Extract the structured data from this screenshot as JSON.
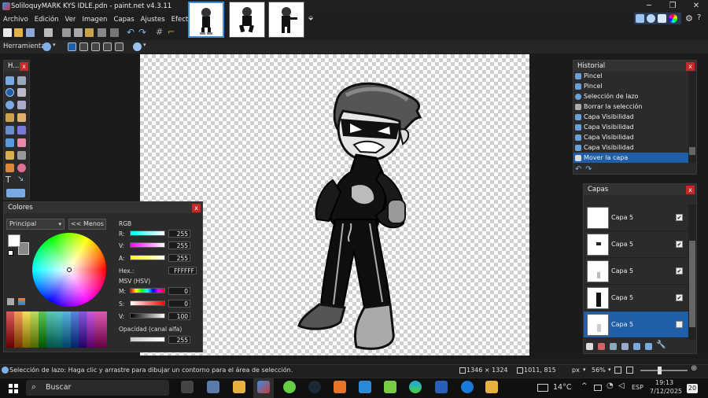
{
  "window": {
    "title": "SoliloquyMARK KYS IDLE.pdn - paint.net v4.3.11"
  },
  "menu": [
    "Archivo",
    "Edición",
    "Ver",
    "Imagen",
    "Capas",
    "Ajustes",
    "Efectos"
  ],
  "tool_options": {
    "label": "Herramienta:"
  },
  "tools_panel": {
    "title": "H..."
  },
  "colors_panel": {
    "title": "Colores",
    "mode": "Principal",
    "less_button": "<< Menos",
    "rgb_label": "RGB",
    "r_label": "R:",
    "g_label": "V:",
    "b_label": "A:",
    "r": "255",
    "g": "255",
    "b": "255",
    "hex_label": "Hex.:",
    "hex": "FFFFFF",
    "hsv_label": "MSV (HSV)",
    "h_label": "M:",
    "s_label": "S:",
    "v_label": "V:",
    "h": "0",
    "s": "0",
    "v": "100",
    "opacity_label": "Opacidad (canal alfa)",
    "opacity": "255"
  },
  "history_panel": {
    "title": "Historial",
    "items": [
      "Pincel",
      "Pincel",
      "Selección de lazo",
      "Borrar la selección",
      "Capa Visibilidad",
      "Capa Visibilidad",
      "Capa Visibilidad",
      "Capa Visibilidad",
      "Mover la capa"
    ],
    "selected_index": 8
  },
  "layers_panel": {
    "title": "Capas",
    "layers": [
      {
        "name": "Capa 5",
        "visible": true
      },
      {
        "name": "Capa 5",
        "visible": true
      },
      {
        "name": "Capa 5",
        "visible": true
      },
      {
        "name": "Capa 5",
        "visible": true
      },
      {
        "name": "Capa 5",
        "visible": false
      }
    ],
    "selected_index": 4
  },
  "status": {
    "hint": "Selección de lazo: Haga clic y arrastre para dibujar un contorno para el área de selección.",
    "image_size": "1346 × 1324",
    "cursor": "1011, 815",
    "units": "px",
    "zoom": "56%"
  },
  "taskbar": {
    "search": "Buscar",
    "temperature": "14°C",
    "lang": "ESP",
    "time": "19:13",
    "date": "7/12/2025",
    "notifications": "20"
  },
  "colors": {
    "accent": "#1f5fa8",
    "close": "#c62828"
  }
}
